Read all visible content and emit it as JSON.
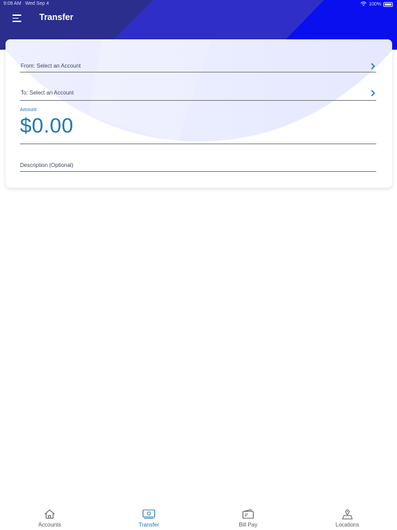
{
  "status_bar": {
    "time": "9:09 AM",
    "date": "Wed Sep 4",
    "battery": "100%"
  },
  "header": {
    "title": "Transfer",
    "menu_icon": "hamburger-menu-icon",
    "colors": {
      "dark": "#2b2e8c",
      "bright": "#0a0ff0"
    }
  },
  "form": {
    "from_label": "From: Select an Account",
    "to_label": "To: Select an Account",
    "amount_label": "Amount",
    "amount_value": "$0.00",
    "description_placeholder": "Description (Optional)",
    "accent_color": "#1f78b4"
  },
  "tabs": [
    {
      "label": "Accounts",
      "icon": "home-icon",
      "active": false
    },
    {
      "label": "Transfer",
      "icon": "money-icon",
      "active": true
    },
    {
      "label": "Bill Pay",
      "icon": "wallet-icon",
      "active": false
    },
    {
      "label": "Locations",
      "icon": "map-pin-icon",
      "active": false
    }
  ]
}
